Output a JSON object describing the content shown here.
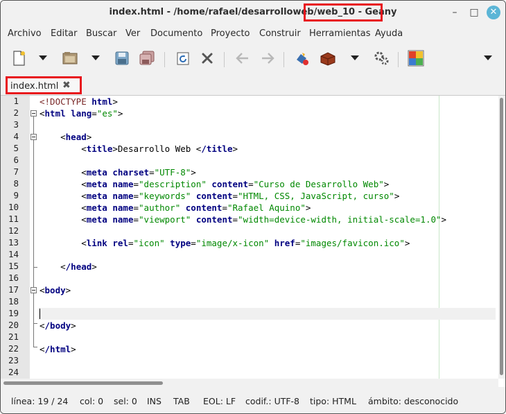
{
  "window": {
    "title_main": "index.html - /home/rafael/desarrolloweb",
    "title_highlight": "/web_10 - Geany",
    "minimize": "–",
    "maximize": "□",
    "close": "✕"
  },
  "menu": {
    "items": [
      "Archivo",
      "Editar",
      "Buscar",
      "Ver",
      "Documento",
      "Proyecto",
      "Construir",
      "Herramientas",
      "Ayuda"
    ]
  },
  "toolbar": {
    "icons": [
      "new-file-icon",
      "open-file-icon",
      "save-icon",
      "save-all-icon",
      "reload-icon",
      "close-file-icon",
      "navigate-back-icon",
      "navigate-forward-icon",
      "compile-icon",
      "build-icon",
      "execute-icon",
      "color-chooser-icon"
    ],
    "overflow": "▾"
  },
  "tabs": [
    {
      "label": "index.html",
      "close": "✖"
    }
  ],
  "editor": {
    "line_numbers": [
      "1",
      "2",
      "3",
      "4",
      "5",
      "6",
      "7",
      "8",
      "9",
      "10",
      "11",
      "12",
      "13",
      "14",
      "15",
      "16",
      "17",
      "18",
      "19",
      "20",
      "21",
      "22",
      "23",
      "24"
    ],
    "lines": [
      "<!DOCTYPE html>",
      "<html lang=\"es\">",
      "",
      "    <head>",
      "        <title>Desarrollo Web </title>",
      "",
      "        <meta charset=\"UTF-8\">",
      "        <meta name=\"description\" content=\"Curso de Desarrollo Web\">",
      "        <meta name=\"keywords\" content=\"HTML, CSS, JavaScript, curso\">",
      "        <meta name=\"author\" content=\"Rafael Aquino\">",
      "        <meta name=\"viewport\" content=\"width=device-width, initial-scale=1.0\">",
      "",
      "        <link rel=\"icon\" type=\"image/x-icon\" href=\"images/favicon.ico\">",
      "",
      "    </head>",
      "",
      "<body>",
      "",
      "",
      "</body>",
      "",
      "</html>",
      "",
      ""
    ],
    "current_line": 19
  },
  "status": {
    "line": "línea: 19 / 24",
    "col": "col: 0",
    "sel": "sel: 0",
    "ins": "INS",
    "tab": "TAB",
    "eol": "EOL: LF",
    "encoding": "codif.: UTF-8",
    "filetype": "tipo: HTML",
    "scope": "ámbito: desconocido"
  },
  "colors": {
    "highlight_box": "#e8141c",
    "tag": "#000080",
    "string": "#008800",
    "doctype": "#7a2828"
  }
}
